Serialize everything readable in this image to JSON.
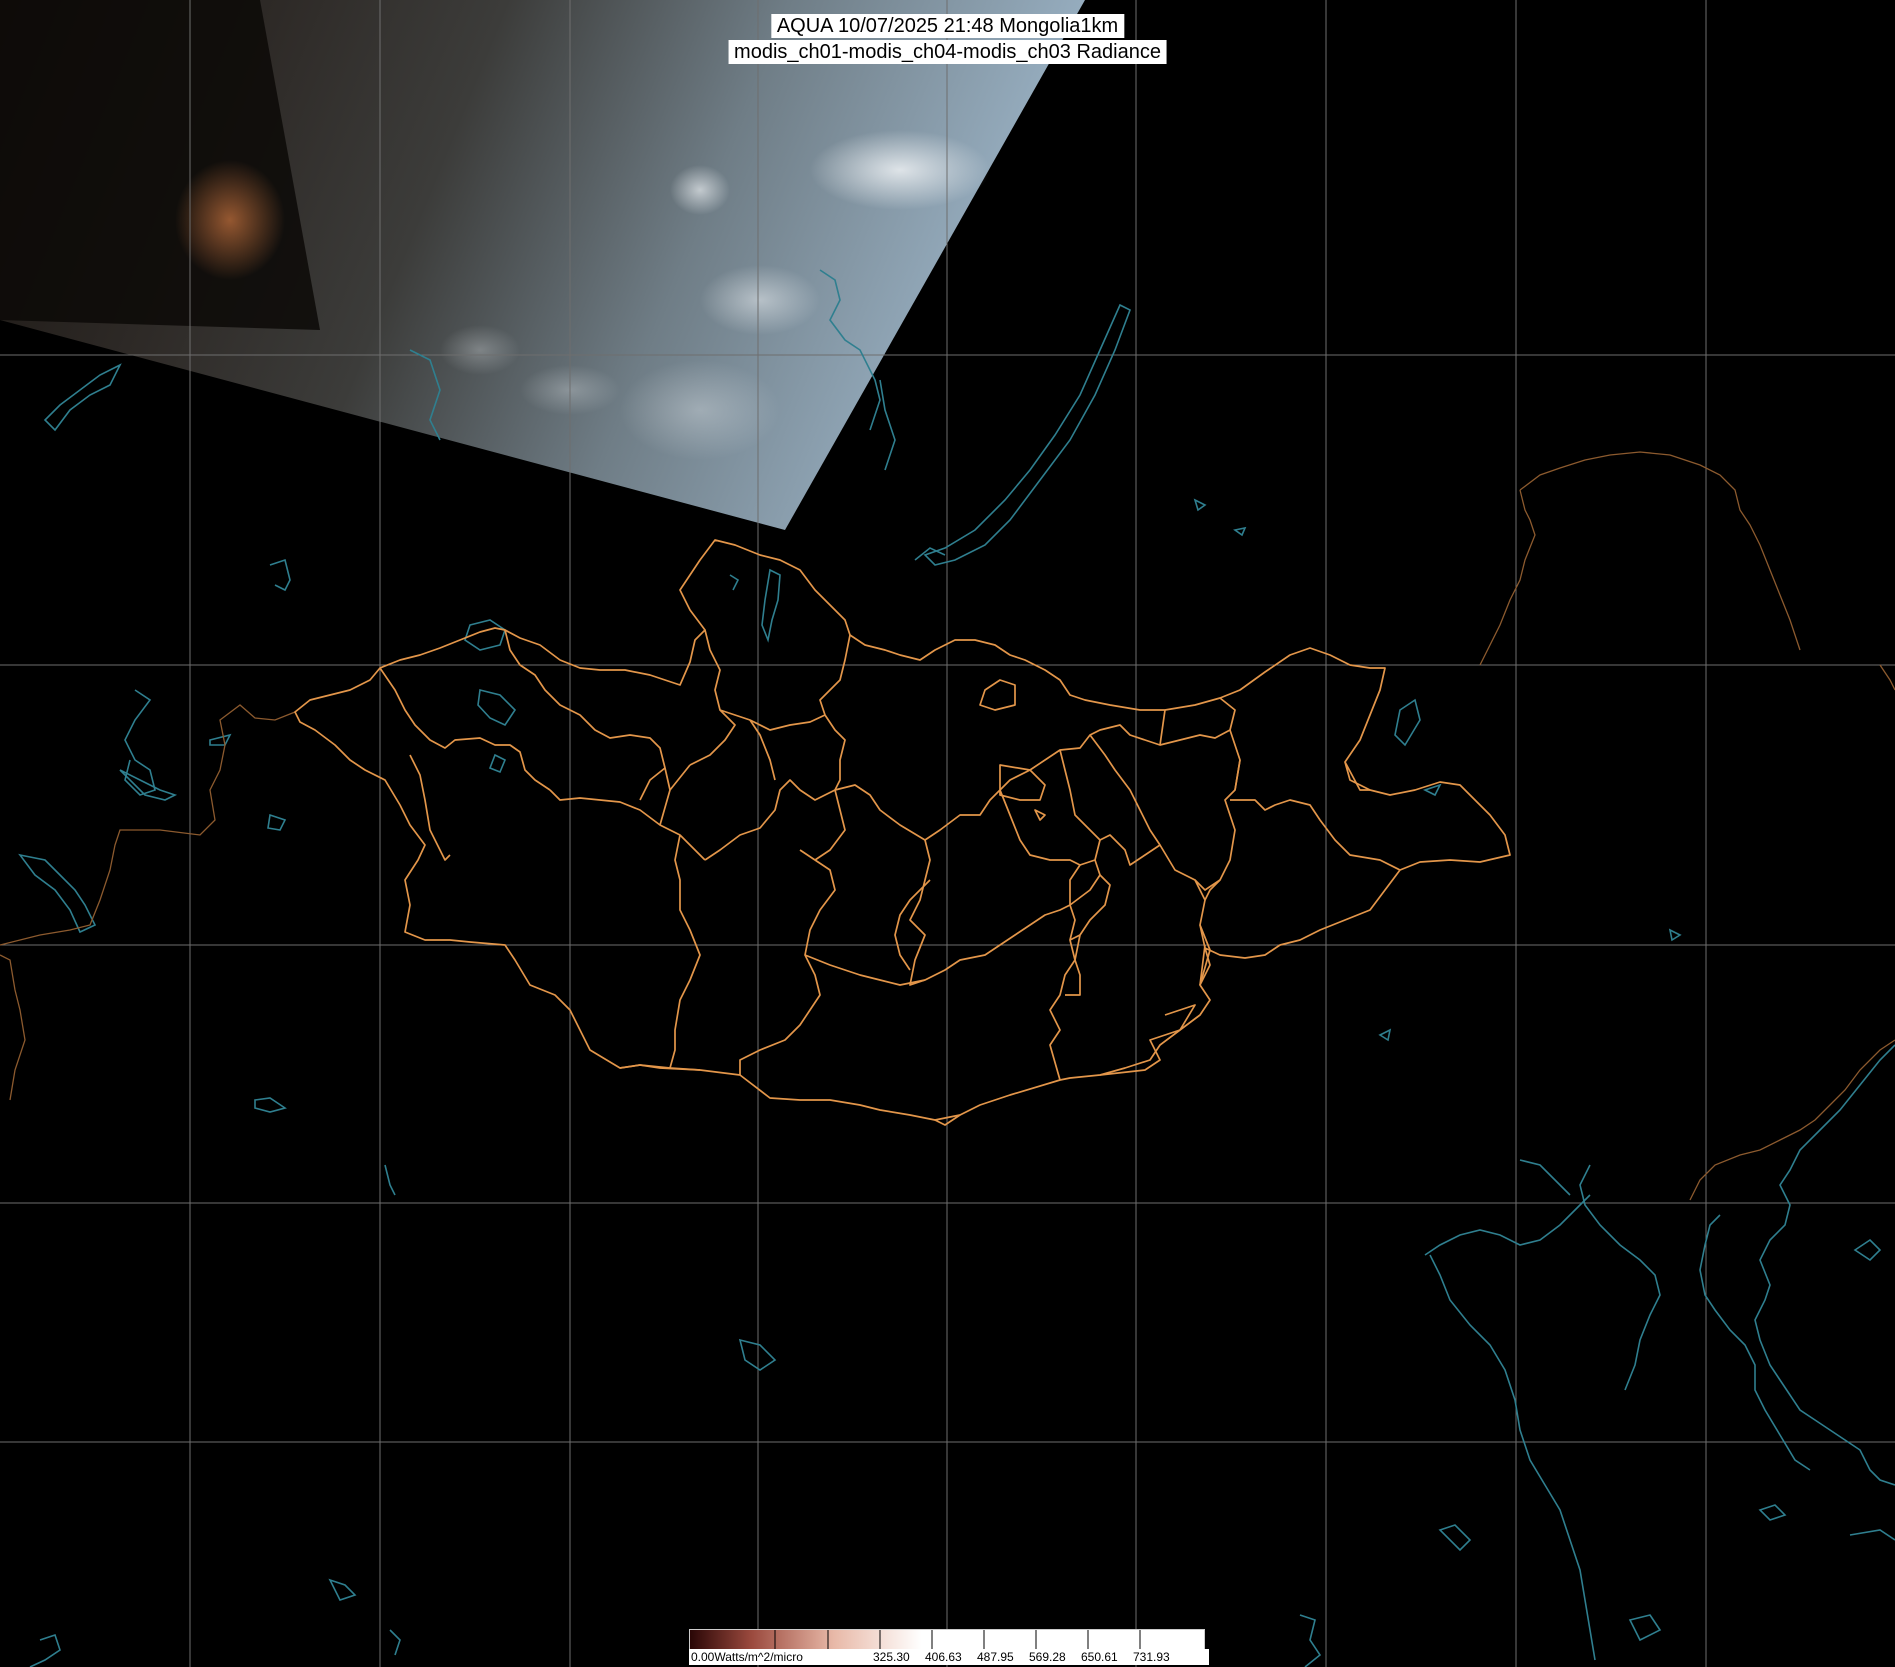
{
  "title": {
    "line1": "AQUA 10/07/2025 21:48 Mongolia1km",
    "line2": "modis_ch01-modis_ch04-modis_ch03 Radiance"
  },
  "colorbar": {
    "unit_label": "0.00Watts/m^2/micro",
    "tick_labels": [
      "325.30",
      "406.63",
      "487.95",
      "569.28",
      "650.61",
      "731.93"
    ]
  },
  "colors": {
    "background": "#000000",
    "gridlines": "#6e6e6e",
    "province_borders": "#e3964a",
    "coastlines": "#2f7f8f",
    "title_box": "#ffffff"
  }
}
